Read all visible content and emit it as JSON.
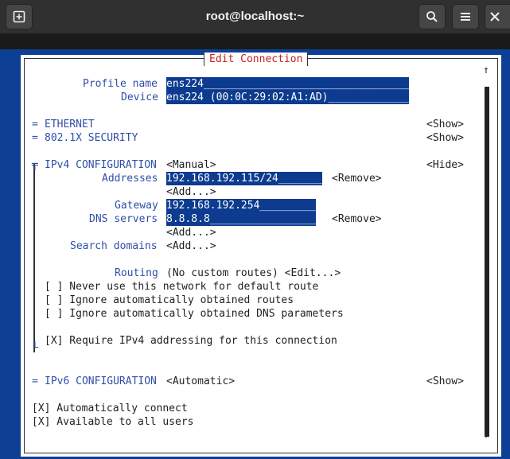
{
  "window": {
    "title": "root@localhost:~"
  },
  "dialog": {
    "title": "Edit Connection"
  },
  "profile": {
    "name_label": "Profile name",
    "name_value": "ens224_________________________________",
    "device_label": "Device",
    "device_value": "ens224 (00:0C:29:02:A1:AD)_____________"
  },
  "ethernet": {
    "marker": "=",
    "label": "ETHERNET",
    "action": "<Show>"
  },
  "security": {
    "marker": "=",
    "label": "802.1X SECURITY",
    "action": "<Show>"
  },
  "ipv4": {
    "marker": "╤",
    "label": "IPv4 CONFIGURATION",
    "method": "<Manual>",
    "action": "<Hide>",
    "addresses_label": "Addresses",
    "address_value": "192.168.192.115/24_______",
    "address_remove": "<Remove>",
    "add_address": "<Add...>",
    "gateway_label": "Gateway",
    "gateway_value": "192.168.192.254_________",
    "dns_label": "DNS servers",
    "dns_value": "8.8.8.8_________________",
    "dns_remove": "<Remove>",
    "add_dns": "<Add...>",
    "search_label": "Search domains",
    "add_search": "<Add...>",
    "routing_label": "Routing",
    "routing_value": "(No custom routes) <Edit...>",
    "never_default": "[ ] Never use this network for default route",
    "ignore_routes": "[ ] Ignore automatically obtained routes",
    "ignore_dns": "[ ] Ignore automatically obtained DNS parameters",
    "require_ipv4": "[X] Require IPv4 addressing for this connection",
    "end_marker": "└"
  },
  "ipv6": {
    "marker": "=",
    "label": "IPv6 CONFIGURATION",
    "method": "<Automatic>",
    "action": "<Show>"
  },
  "options": {
    "auto_connect": "[X] Automatically connect",
    "all_users": "[X] Available to all users"
  },
  "scrollbar": {
    "up": "↑",
    "down": "↓"
  },
  "icons": {
    "new_tab": "new-tab-icon",
    "search": "search-icon",
    "menu": "hamburger-menu-icon"
  }
}
